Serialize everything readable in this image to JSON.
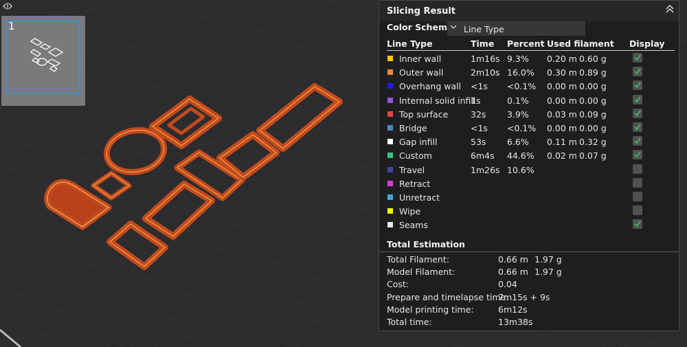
{
  "viewport": {
    "plate_number": "1",
    "colors": {
      "background": "#2c2c2f",
      "grid": "#3a3a3d",
      "model": "#c24a1e",
      "model_edge": "#e88a2a",
      "seam": "#f0f0f0"
    }
  },
  "panel": {
    "title": "Slicing Result",
    "color_scheme_label": "Color Scheme",
    "color_scheme_value": "Line Type",
    "columns": {
      "type": "Line Type",
      "time": "Time",
      "percent": "Percent",
      "used": "Used filament",
      "display": "Display"
    },
    "rows": [
      {
        "color": "#f5c518",
        "name": "Inner wall",
        "time": "1m16s",
        "percent": "9.3%",
        "length": "0.20 m",
        "weight": "0.60 g",
        "display": true
      },
      {
        "color": "#f5853a",
        "name": "Outer wall",
        "time": "2m10s",
        "percent": "16.0%",
        "length": "0.30 m",
        "weight": "0.89 g",
        "display": true
      },
      {
        "color": "#1c1cf0",
        "name": "Overhang wall",
        "time": "<1s",
        "percent": "<0.1%",
        "length": "0.00 m",
        "weight": "0.00 g",
        "display": true
      },
      {
        "color": "#9a52d6",
        "name": "Internal solid infill",
        "time": "1s",
        "percent": "0.1%",
        "length": "0.00 m",
        "weight": "0.00 g",
        "display": true
      },
      {
        "color": "#e84545",
        "name": "Top surface",
        "time": "32s",
        "percent": "3.9%",
        "length": "0.03 m",
        "weight": "0.09 g",
        "display": true
      },
      {
        "color": "#4f84c4",
        "name": "Bridge",
        "time": "<1s",
        "percent": "<0.1%",
        "length": "0.00 m",
        "weight": "0.00 g",
        "display": true
      },
      {
        "color": "#ffffff",
        "name": "Gap infill",
        "time": "53s",
        "percent": "6.6%",
        "length": "0.11 m",
        "weight": "0.32 g",
        "display": true
      },
      {
        "color": "#38c77a",
        "name": "Custom",
        "time": "6m4s",
        "percent": "44.6%",
        "length": "0.02 m",
        "weight": "0.07 g",
        "display": true
      },
      {
        "color": "#3b4a9e",
        "name": "Travel",
        "time": "1m26s",
        "percent": "10.6%",
        "length": "",
        "weight": "",
        "display": false
      },
      {
        "color": "#d63cd6",
        "name": "Retract",
        "time": "",
        "percent": "",
        "length": "",
        "weight": "",
        "display": false
      },
      {
        "color": "#3fa7d6",
        "name": "Unretract",
        "time": "",
        "percent": "",
        "length": "",
        "weight": "",
        "display": false
      },
      {
        "color": "#f2f20a",
        "name": "Wipe",
        "time": "",
        "percent": "",
        "length": "",
        "weight": "",
        "display": false
      },
      {
        "color": "#e8e8e8",
        "name": "Seams",
        "time": "",
        "percent": "",
        "length": "",
        "weight": "",
        "display": true
      }
    ],
    "estimation": {
      "title": "Total Estimation",
      "items": [
        {
          "label": "Total Filament:",
          "v1": "0.66 m",
          "v2": "1.97 g"
        },
        {
          "label": "Model Filament:",
          "v1": "0.66 m",
          "v2": "1.97 g"
        },
        {
          "label": "Cost:",
          "v1": "0.04",
          "v2": ""
        },
        {
          "label": "Prepare and timelapse time:",
          "v1": "7m15s + 9s",
          "v2": ""
        },
        {
          "label": "Model printing time:",
          "v1": "6m12s",
          "v2": ""
        },
        {
          "label": "Total time:",
          "v1": "13m38s",
          "v2": ""
        }
      ]
    }
  }
}
